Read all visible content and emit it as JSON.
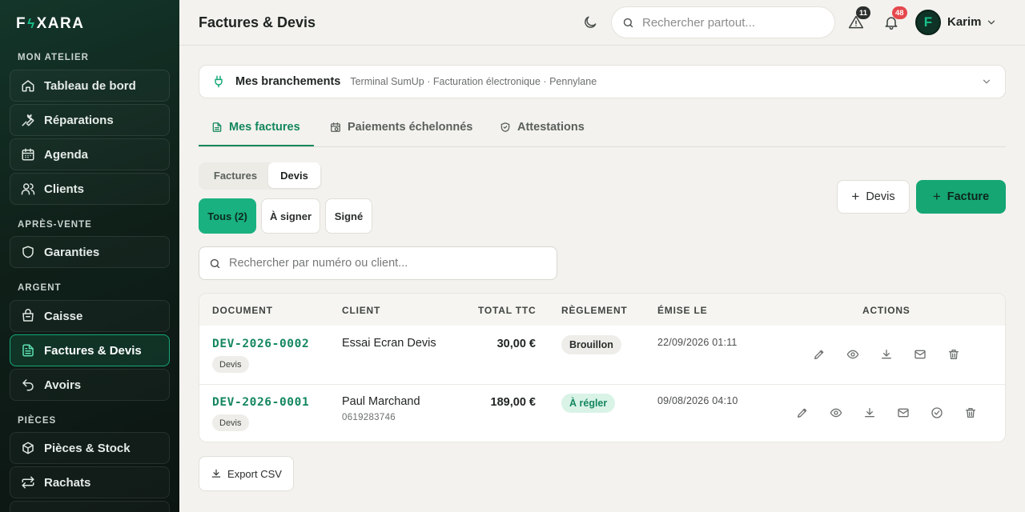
{
  "brand": {
    "logo_left": "F",
    "logo_right": "XARA"
  },
  "sidebar": {
    "sections": [
      {
        "title": "MON ATELIER",
        "items": [
          {
            "label": "Tableau de bord",
            "icon": "home-icon"
          },
          {
            "label": "Réparations",
            "icon": "wrench-icon"
          },
          {
            "label": "Agenda",
            "icon": "calendar-icon"
          },
          {
            "label": "Clients",
            "icon": "users-icon"
          }
        ]
      },
      {
        "title": "APRÈS-VENTE",
        "items": [
          {
            "label": "Garanties",
            "icon": "shield-icon"
          }
        ]
      },
      {
        "title": "ARGENT",
        "items": [
          {
            "label": "Caisse",
            "icon": "register-icon"
          },
          {
            "label": "Factures & Devis",
            "icon": "document-icon",
            "active": true
          },
          {
            "label": "Avoirs",
            "icon": "undo-icon"
          }
        ]
      },
      {
        "title": "PIÈCES",
        "items": [
          {
            "label": "Pièces & Stock",
            "icon": "box-icon"
          },
          {
            "label": "Rachats",
            "icon": "swap-icon"
          }
        ]
      }
    ]
  },
  "header": {
    "title": "Factures & Devis",
    "search_placeholder": "Rechercher partout...",
    "alerts_count": "11",
    "notifications_count": "48",
    "avatar_initial": "F",
    "user_name": "Karim"
  },
  "connections": {
    "title": "Mes branchements",
    "subtitle": "Terminal SumUp · Facturation électronique · Pennylane"
  },
  "tabs": [
    {
      "label": "Mes factures",
      "active": true
    },
    {
      "label": "Paiements échelonnés"
    },
    {
      "label": "Attestations"
    }
  ],
  "segment": {
    "options": [
      "Factures",
      "Devis"
    ],
    "selected": "Devis"
  },
  "filters": [
    {
      "label": "Tous (2)",
      "active": true
    },
    {
      "label": "À signer"
    },
    {
      "label": "Signé"
    }
  ],
  "actions": {
    "new_quote": "Devis",
    "new_invoice": "Facture",
    "export": "Export CSV"
  },
  "list_search_placeholder": "Rechercher par numéro ou client...",
  "table": {
    "columns": [
      "DOCUMENT",
      "CLIENT",
      "TOTAL TTC",
      "RÈGLEMENT",
      "ÉMISE LE",
      "ACTIONS"
    ],
    "rows": [
      {
        "number": "DEV-2026-0002",
        "type": "Devis",
        "client": "Essai Ecran Devis",
        "phone": "",
        "total": "30,00 €",
        "status": "Brouillon",
        "issued": "22/09/2026 01:11"
      },
      {
        "number": "DEV-2026-0001",
        "type": "Devis",
        "client": "Paul Marchand",
        "phone": "0619283746",
        "total": "189,00 €",
        "status": "À régler",
        "issued": "09/08/2026 04:10"
      }
    ]
  },
  "colors": {
    "accent": "#15a674",
    "accent_dark": "#14875f",
    "sidebar_bg": "#0f2019",
    "alert_badge": "#2b2f2d",
    "notif_badge": "#e5484d"
  }
}
